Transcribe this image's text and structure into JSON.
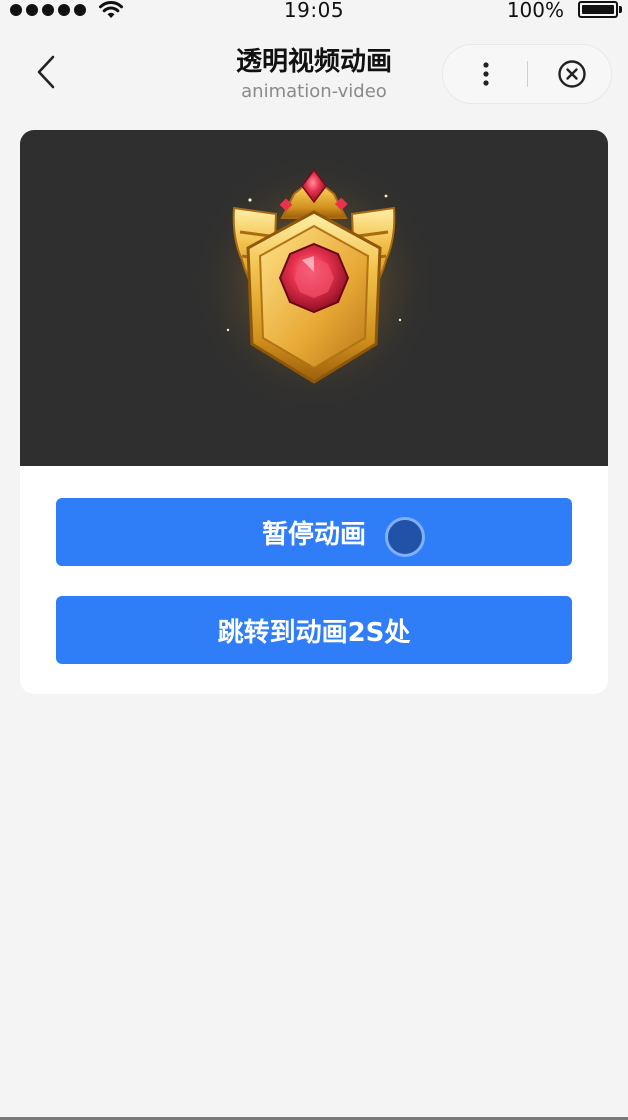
{
  "status_bar": {
    "time": "19:05",
    "battery_percent": "100%",
    "signal_bars": 5,
    "wifi_icon": "wifi-icon",
    "battery_icon": "battery-full-icon"
  },
  "nav": {
    "title": "透明视频动画",
    "subtitle": "animation-video",
    "back_icon": "chevron-left-icon",
    "more_icon": "more-vertical-icon",
    "close_icon": "circle-close-icon"
  },
  "video": {
    "background_color": "#2f2f2f",
    "content": "gold-ruby-badge-animation"
  },
  "buttons": {
    "pause_label": "暂停动画",
    "seek_label": "跳转到动画2S处",
    "color": "#2f7df7"
  },
  "colors": {
    "page_background": "#f4f4f4",
    "accent": "#2f7df7"
  }
}
